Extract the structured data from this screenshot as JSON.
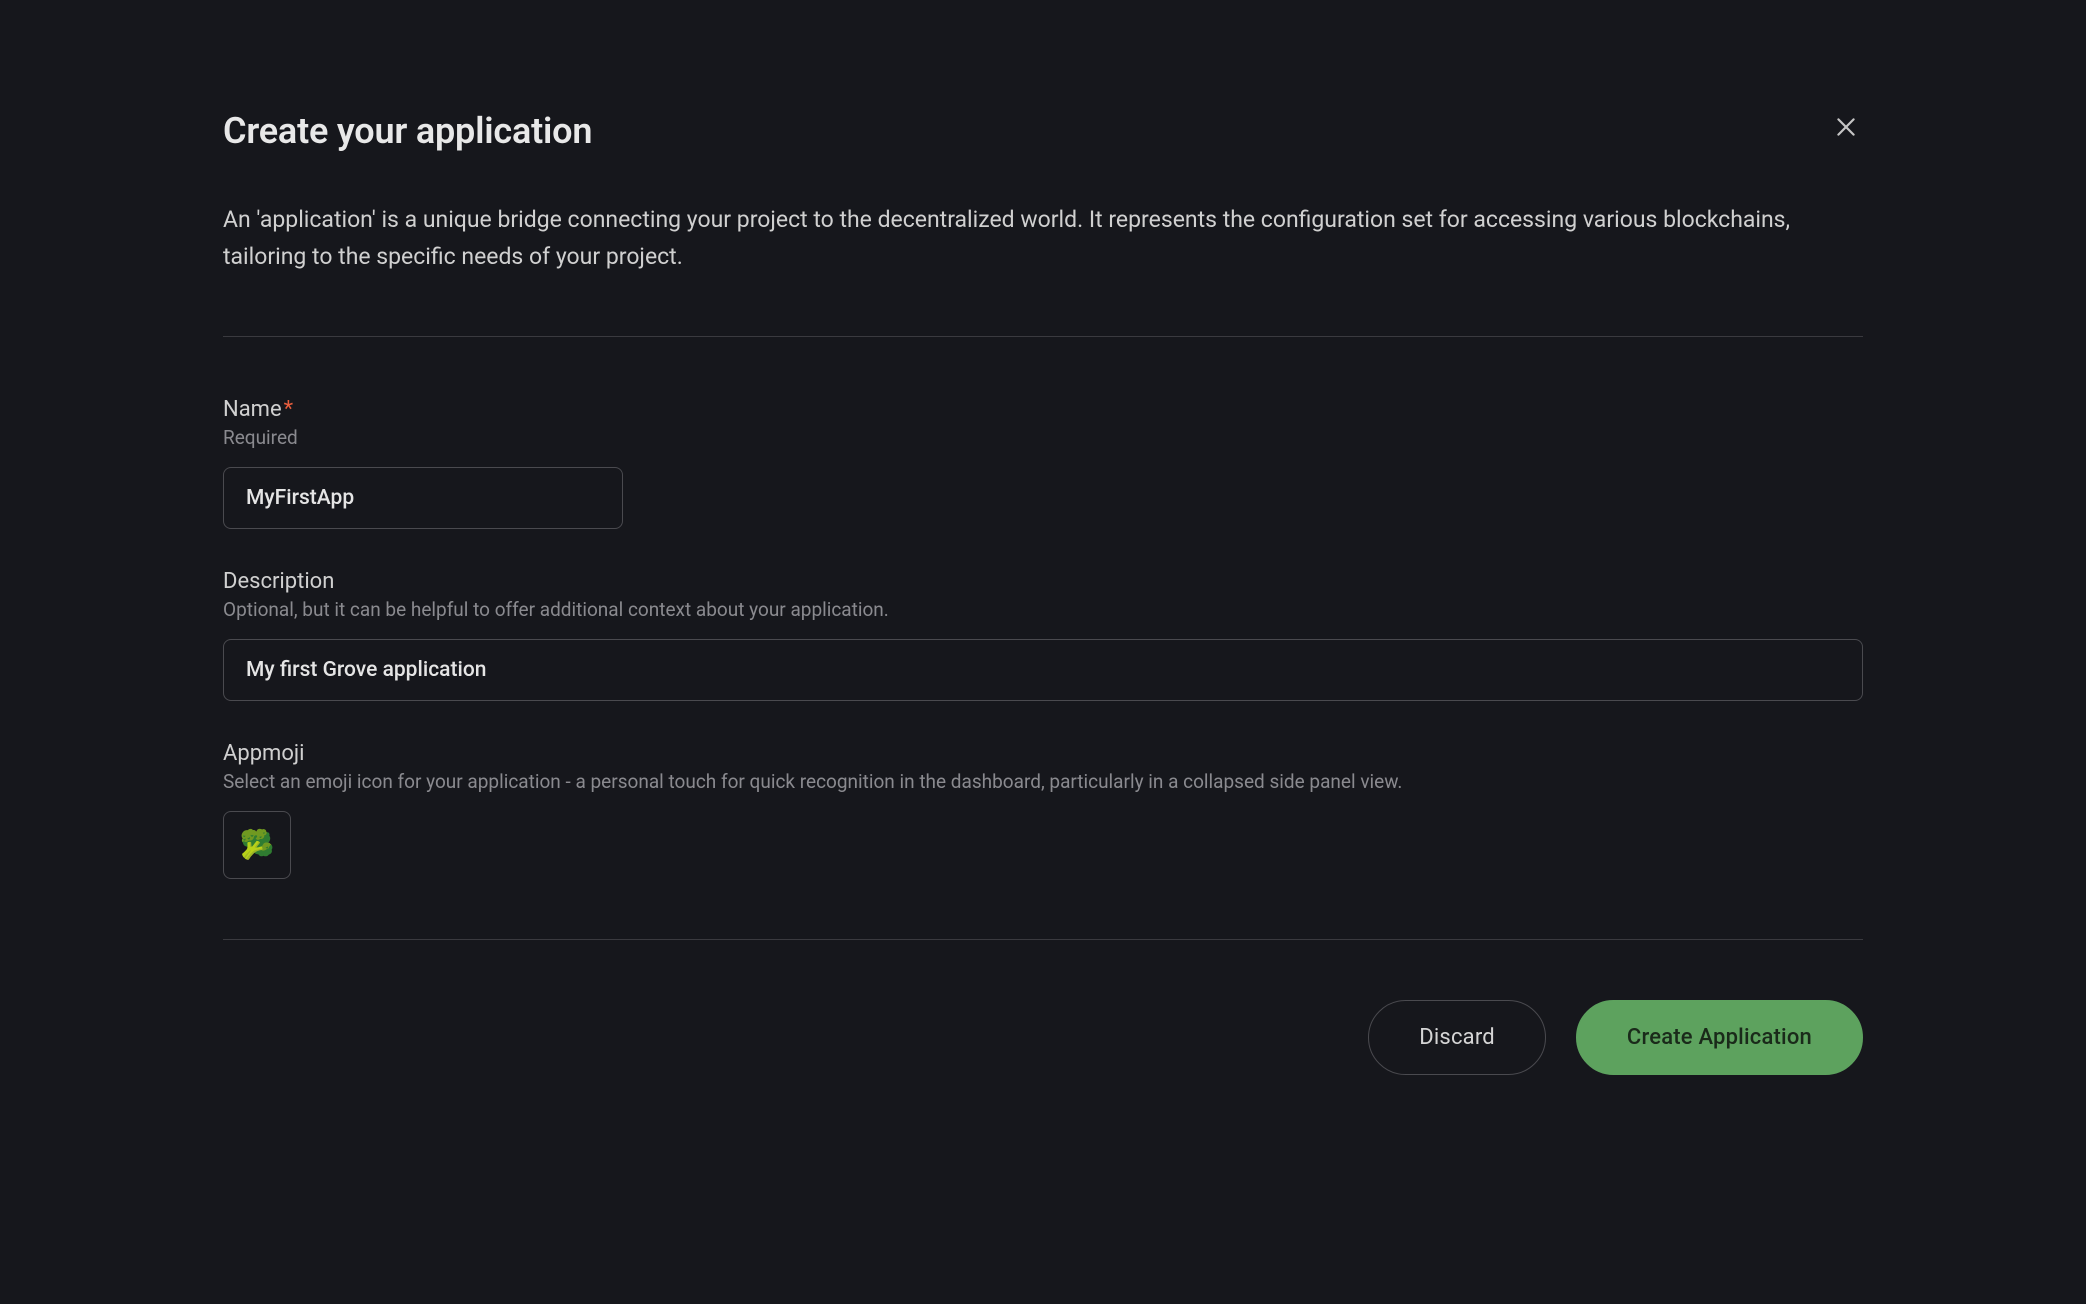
{
  "modal": {
    "title": "Create your application",
    "description": "An 'application' is a unique bridge connecting your project to the decentralized world. It represents the configuration set for accessing various blockchains, tailoring to the specific needs of your project."
  },
  "fields": {
    "name": {
      "label": "Name",
      "hint": "Required",
      "value": "MyFirstApp"
    },
    "description": {
      "label": "Description",
      "hint": "Optional, but it can be helpful to offer additional context about your application.",
      "value": "My first Grove application"
    },
    "appmoji": {
      "label": "Appmoji",
      "hint": "Select an emoji icon for your application - a personal touch for quick recognition in the dashboard, particularly in a collapsed side panel view.",
      "value": "🥦"
    }
  },
  "buttons": {
    "discard": "Discard",
    "create": "Create Application"
  }
}
